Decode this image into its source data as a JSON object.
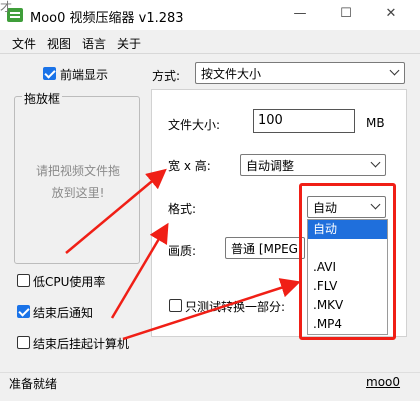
{
  "window": {
    "title": "Moo0 视频压缩器 v1.283",
    "minimize_glyph": "—",
    "maximize_glyph": "☐",
    "close_glyph": "✕",
    "bg_glyph_top": "才",
    "bg_glyph_mid": "A"
  },
  "menu": [
    "文件",
    "视图",
    "语言",
    "关于"
  ],
  "left": {
    "topmost_label": "前端显示",
    "topmost_checked": true,
    "drag_frame_title": "拖放框",
    "drop_hint_line1": "请把视频文件拖",
    "drop_hint_line2": "放到这里!",
    "low_cpu_label": "低CPU使用率",
    "low_cpu_checked": false,
    "notify_label": "结束后通知",
    "notify_checked": true,
    "shutdown_label": "结束后挂起计算机",
    "shutdown_checked": false
  },
  "method": {
    "label": "方式:",
    "value": "按文件大小"
  },
  "settings": {
    "filesize_label": "文件大小:",
    "filesize_value": "100",
    "filesize_unit": "MB",
    "wh_label": "宽 x 高:",
    "wh_value": "自动调整",
    "format_label": "格式:",
    "format_value": "自动",
    "quality_label": "画质:",
    "quality_value": "普通  [MPEG",
    "test_label": "只测试转换一部分:",
    "test_checked": false
  },
  "format_options": [
    "自动",
    "",
    "",
    ".AVI",
    ".FLV",
    ".MKV",
    ".MP4"
  ],
  "status": {
    "text": "准备就绪",
    "link": "moo0"
  },
  "colors": {
    "accent": "#1f6fdc",
    "highlight_red": "#f01f16"
  }
}
